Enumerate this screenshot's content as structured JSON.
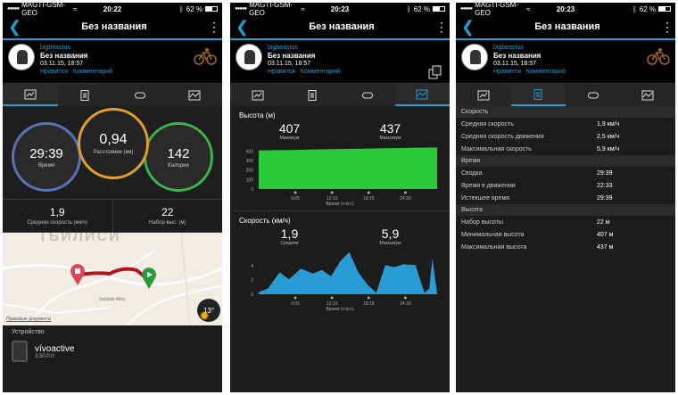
{
  "status": {
    "carrier": "MAGTI-GSM-GEO",
    "battery": "62 %",
    "battery_level": 0.62,
    "times": [
      "20:22",
      "20:23",
      "20:23"
    ]
  },
  "nav": {
    "title": "Без названия"
  },
  "user": {
    "name": "bigbeastus",
    "activity_title": "Без названия",
    "datetime": "03.11.15, 18:57",
    "like": "Нравится",
    "comment": "Комментарий"
  },
  "screen1": {
    "time": {
      "value": "29:39",
      "label": "Время"
    },
    "distance": {
      "value": "0,94",
      "label": "Расстояние (км)"
    },
    "calories": {
      "value": "142",
      "label": "Калории"
    },
    "avg_speed": {
      "value": "1,9",
      "label": "Средняя скорость (км/ч)"
    },
    "elev_gain": {
      "value": "22",
      "label": "Набор выс. (м)"
    },
    "map": {
      "city": "ТБИЛИСИ",
      "street": "Solalaki Alley",
      "legal": "Правовые документы",
      "temperature": "13°"
    },
    "device": {
      "label": "Устройство",
      "name": "vívoactive",
      "version": "3.30.0.0"
    }
  },
  "screen2": {
    "elevation": {
      "title": "Высота (м)",
      "min": {
        "value": "407",
        "label": "Минимум"
      },
      "max": {
        "value": "437",
        "label": "Максимум"
      },
      "axis_title": "Время (ч:м:с)"
    },
    "speed": {
      "title": "Скорость (км/ч)",
      "avg": {
        "value": "1,9",
        "label": "Средняя"
      },
      "max": {
        "value": "5,9",
        "label": "Максимум"
      },
      "axis_title": "Время (ч:м:с)"
    }
  },
  "screen3": {
    "groups": [
      {
        "title": "Скорость",
        "rows": [
          {
            "k": "Средняя скорость",
            "v": "1,9 км/ч"
          },
          {
            "k": "Средняя скорость движения",
            "v": "2,5 км/ч"
          },
          {
            "k": "Максимальная скорость",
            "v": "5,9 км/ч"
          }
        ]
      },
      {
        "title": "Время",
        "rows": [
          {
            "k": "Сводка",
            "v": "29:39"
          },
          {
            "k": "Время в движении",
            "v": "22:33"
          },
          {
            "k": "Истекшее время",
            "v": "29:39"
          }
        ]
      },
      {
        "title": "Высота",
        "rows": [
          {
            "k": "Набор высоты",
            "v": "22 м"
          },
          {
            "k": "Минимальная высота",
            "v": "407 м"
          },
          {
            "k": "Максимальная высота",
            "v": "437 м"
          }
        ]
      }
    ]
  },
  "chart_data": [
    {
      "type": "area",
      "title": "Высота (м)",
      "xlabel": "Время (ч:м:с)",
      "x_ticks": [
        "6:05",
        "12:10",
        "18:15",
        "24:20"
      ],
      "y_ticks": [
        0,
        100,
        200,
        300,
        400
      ],
      "ylim": [
        0,
        450
      ],
      "x": [
        0,
        3,
        6,
        9,
        12,
        15,
        18,
        21,
        24,
        27,
        29.6
      ],
      "values": [
        407,
        409,
        412,
        416,
        419,
        422,
        426,
        429,
        432,
        435,
        437
      ],
      "color": "#2bd33b"
    },
    {
      "type": "area",
      "title": "Скорость (км/ч)",
      "xlabel": "Время (ч:м:с)",
      "x_ticks": [
        "6:05",
        "12:10",
        "18:15",
        "24:20"
      ],
      "y_ticks": [
        0,
        2,
        4
      ],
      "ylim": [
        0,
        6
      ],
      "x": [
        0,
        1.5,
        3.5,
        5,
        7,
        9,
        10.5,
        12,
        13.5,
        15,
        16.5,
        18,
        19.5,
        21,
        22.5,
        24,
        26,
        27.5,
        28.3,
        28.8,
        29.6
      ],
      "values": [
        0.3,
        0.8,
        3.1,
        2.1,
        3.6,
        2.9,
        3.4,
        2.5,
        4.6,
        5.9,
        3.1,
        1.4,
        0.2,
        4.1,
        3.8,
        4.2,
        4.1,
        0.2,
        0.8,
        5.0,
        0.1
      ],
      "color": "#2aa3df"
    }
  ]
}
